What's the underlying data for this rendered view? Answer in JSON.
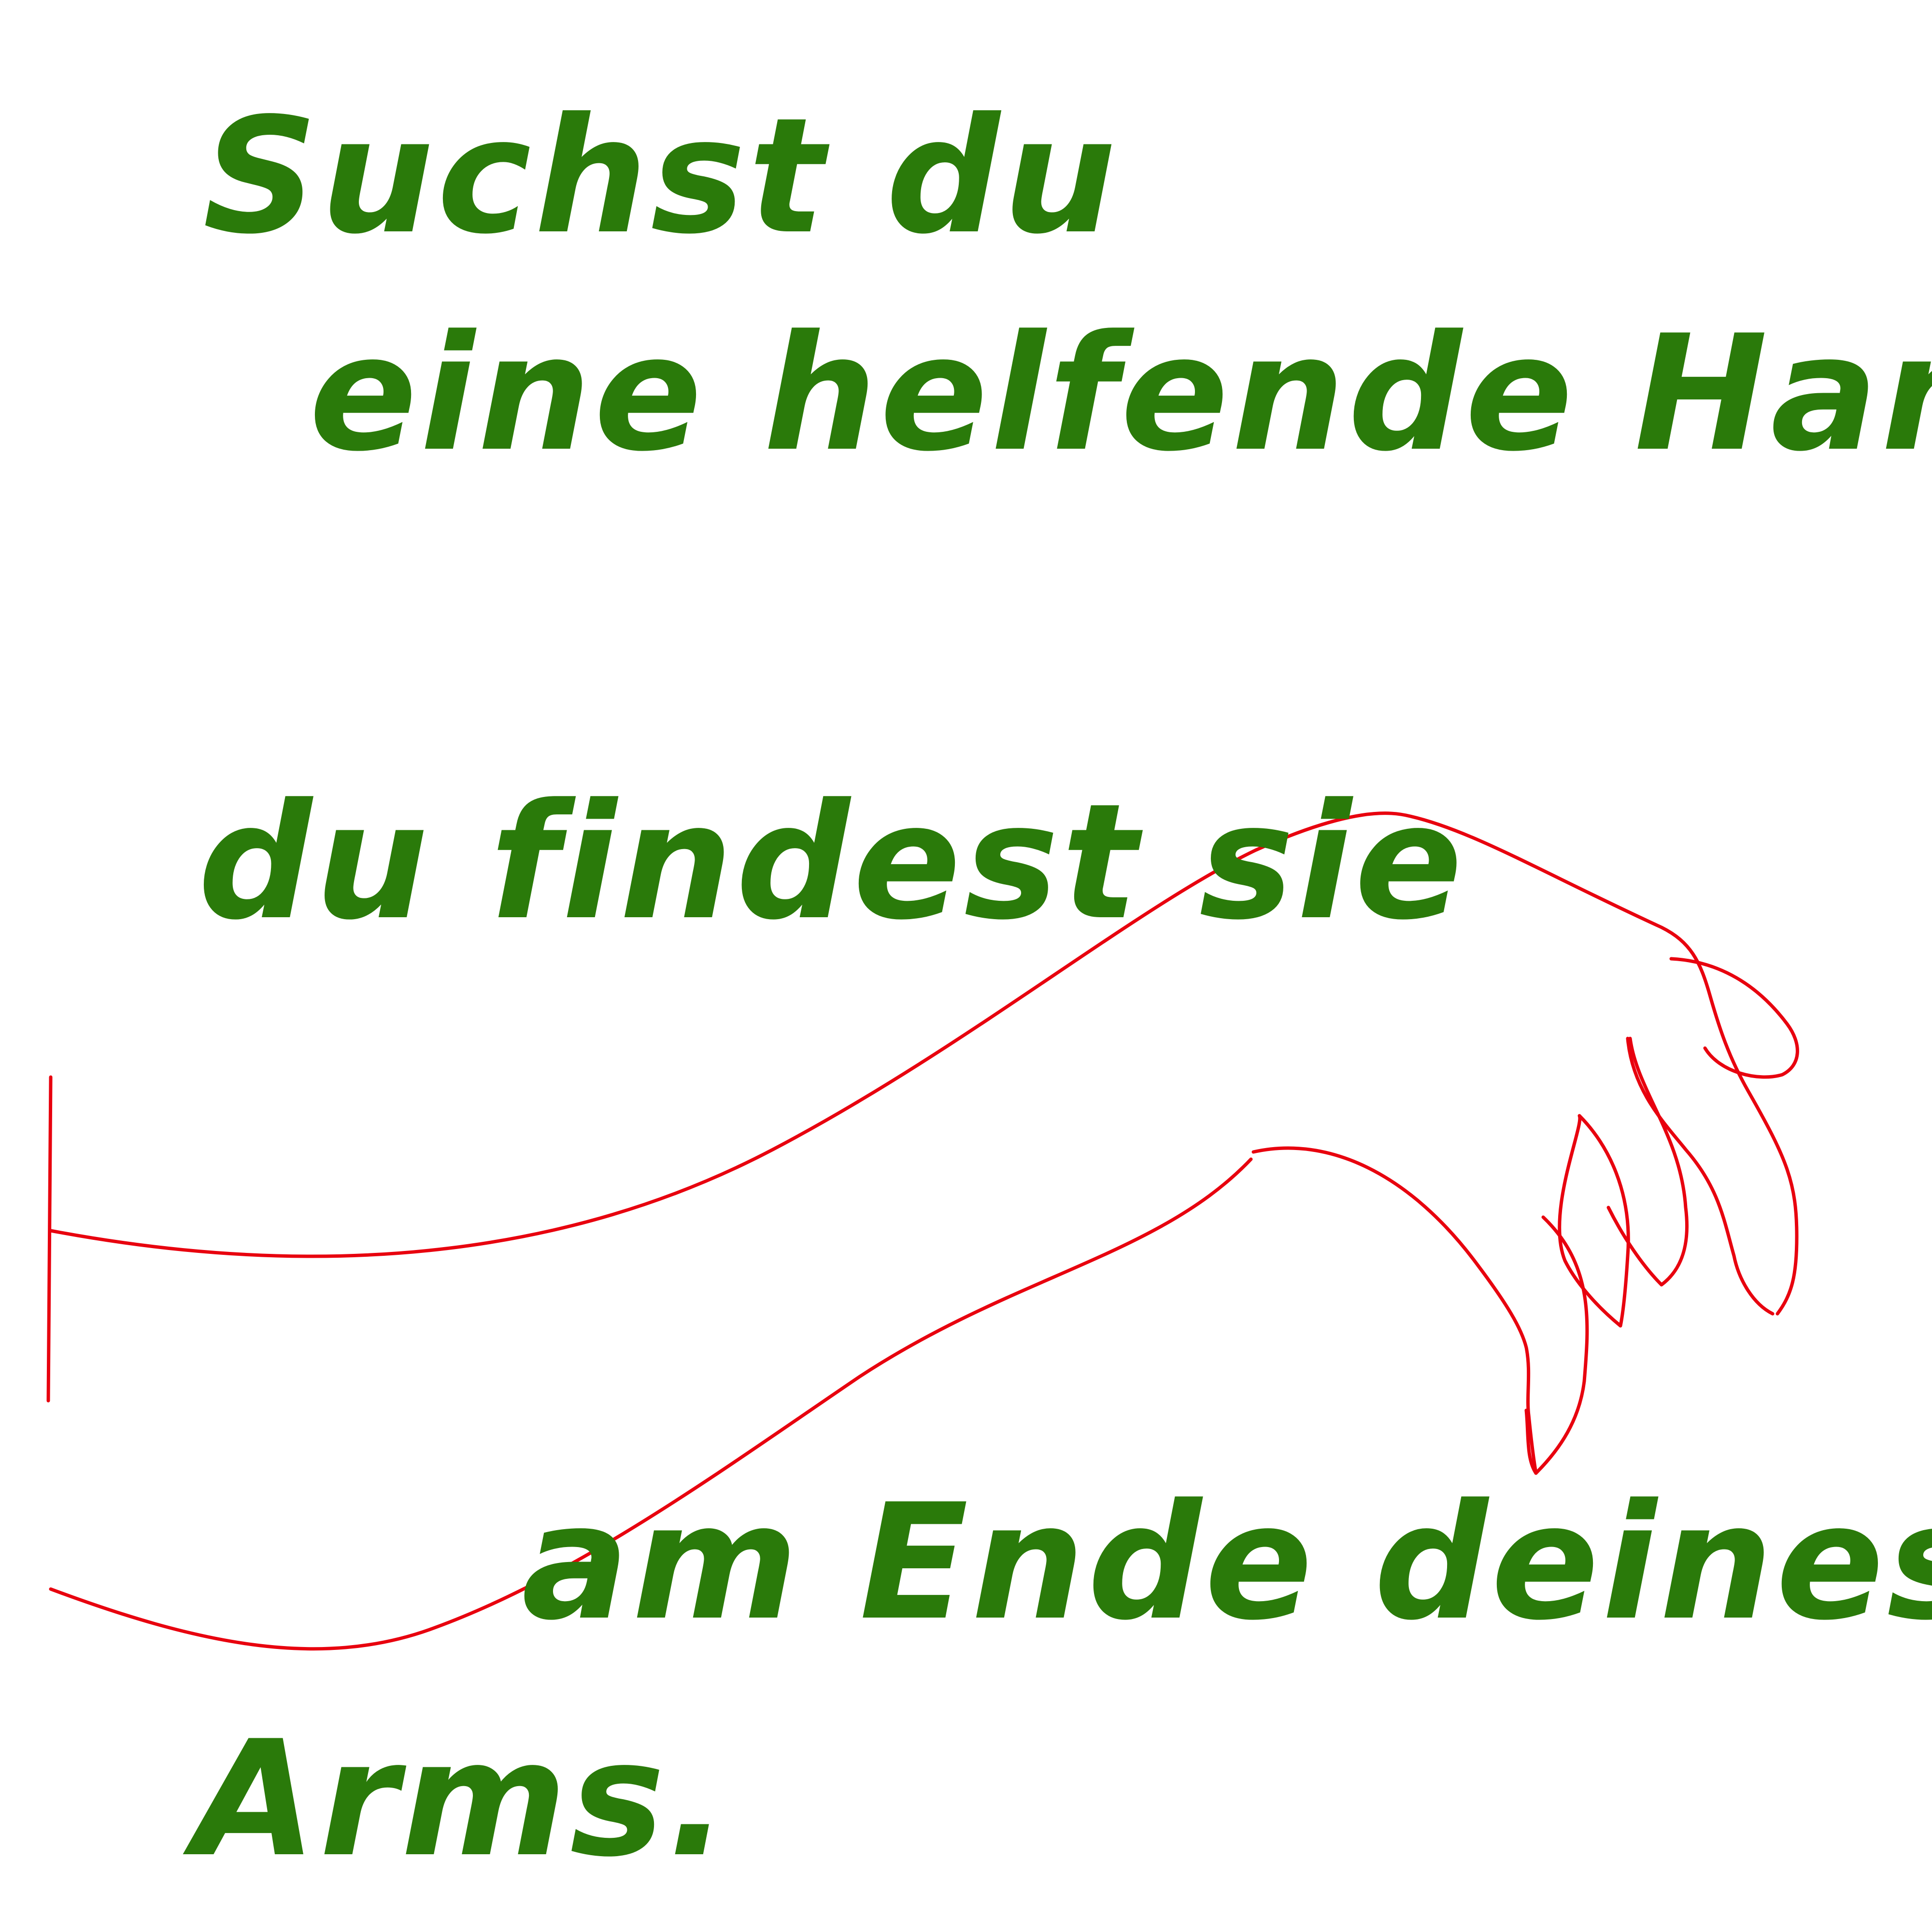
{
  "text": {
    "line1": "Suchst du",
    "line2": "eine helfende Hand,",
    "line3": "du findest sie",
    "line4": "am Ende deines",
    "line5": "Arms."
  },
  "colors": {
    "text": "#2a7a0a",
    "drawing": "#e8000e",
    "background": "#ffffff"
  }
}
